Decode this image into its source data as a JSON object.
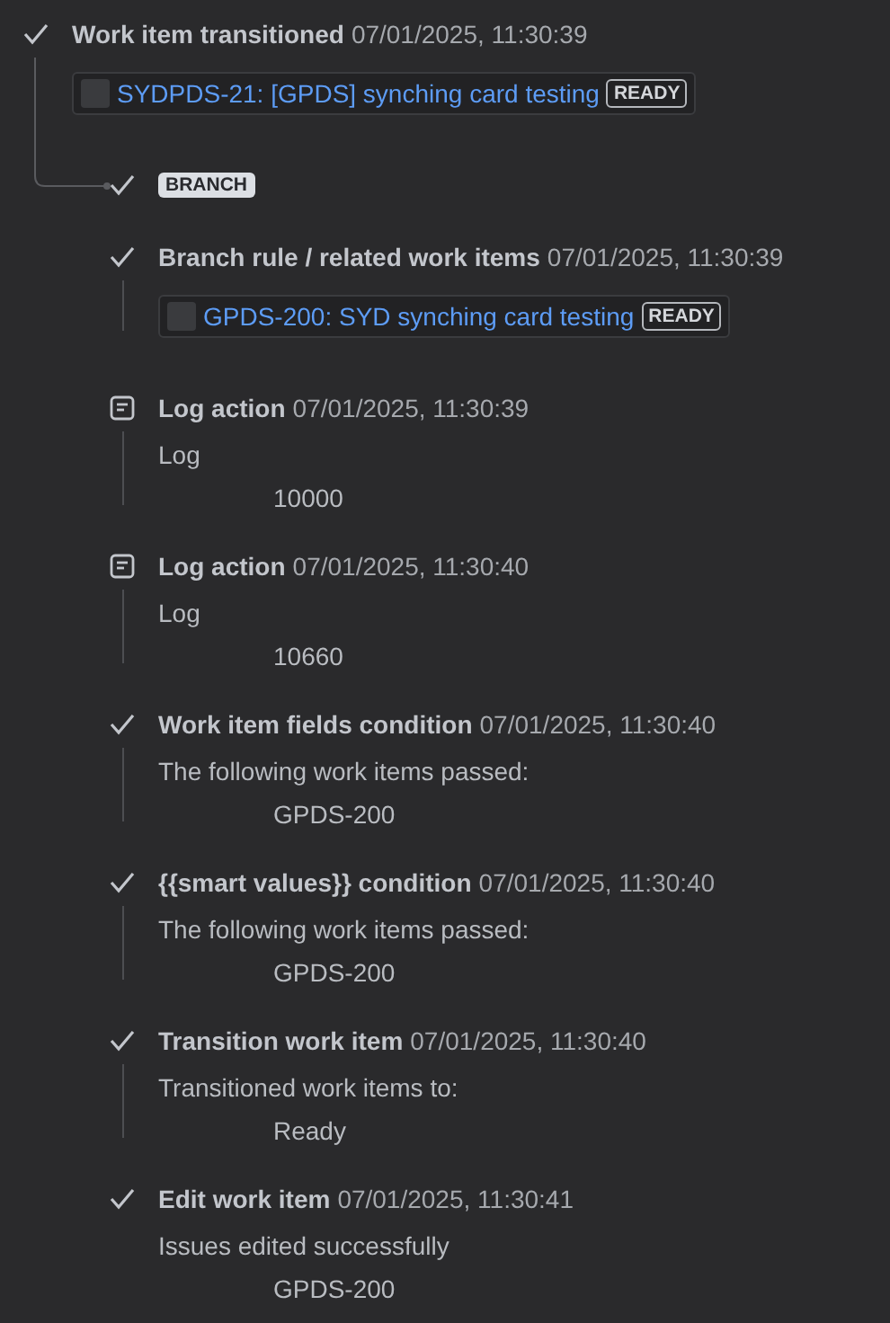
{
  "root": {
    "title": "Work item transitioned",
    "time": "07/01/2025, 11:30:39",
    "card": {
      "link": "SYDPDS-21: [GPDS] synching card testing",
      "status": "READY"
    }
  },
  "branch": {
    "label": "BRANCH",
    "steps": [
      {
        "kind": "success",
        "title": "Branch rule / related work items",
        "time": "07/01/2025, 11:30:39",
        "card": {
          "link": "GPDS-200: SYD synching card testing",
          "status": "READY"
        }
      },
      {
        "kind": "log",
        "title": "Log action",
        "time": "07/01/2025, 11:30:39",
        "detail": "Log",
        "value": "10000"
      },
      {
        "kind": "log",
        "title": "Log action",
        "time": "07/01/2025, 11:30:40",
        "detail": "Log",
        "value": "10660"
      },
      {
        "kind": "success",
        "title": "Work item fields condition",
        "time": "07/01/2025, 11:30:40",
        "detail": "The following work items passed:",
        "value": "GPDS-200"
      },
      {
        "kind": "success",
        "title": "{{smart values}} condition",
        "time": "07/01/2025, 11:30:40",
        "detail": "The following work items passed:",
        "value": "GPDS-200"
      },
      {
        "kind": "success",
        "title": "Transition work item",
        "time": "07/01/2025, 11:30:40",
        "detail": "Transitioned work items to:",
        "value": "Ready"
      },
      {
        "kind": "success",
        "title": "Edit work item",
        "time": "07/01/2025, 11:30:41",
        "detail": "Issues edited successfully",
        "value": "GPDS-200"
      }
    ]
  }
}
